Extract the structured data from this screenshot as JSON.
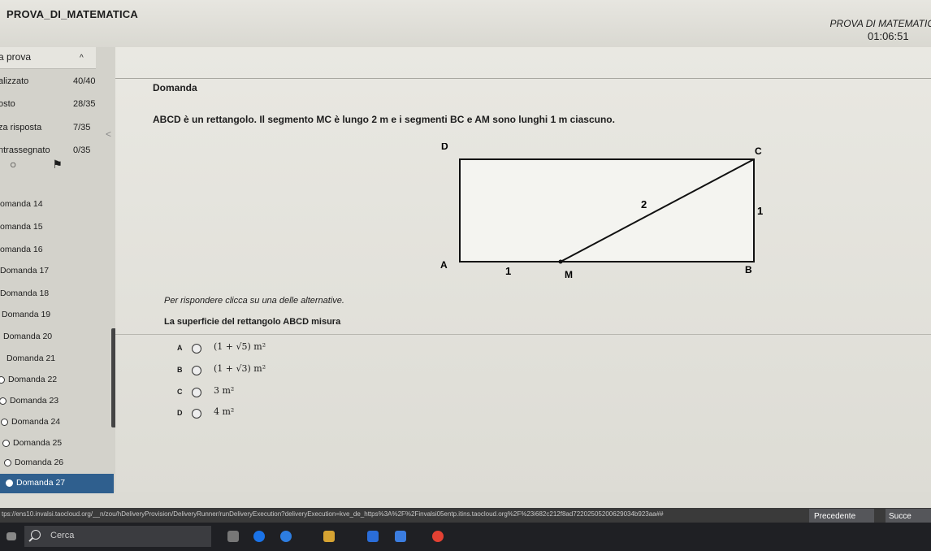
{
  "header": {
    "app_title": "PROVA_DI_MATEMATICA",
    "exam_name": "PROVA DI MATEMATIC",
    "timer": "01:06:51"
  },
  "sidebar": {
    "section_label": "a prova",
    "stats": [
      {
        "label": "alizzato",
        "value": "40/40"
      },
      {
        "label": "osto",
        "value": "28/35"
      },
      {
        "label": "za risposta",
        "value": "7/35"
      },
      {
        "label": "ntrassegnato",
        "value": "0/35"
      }
    ],
    "questions": [
      {
        "label": "omanda 14"
      },
      {
        "label": "omanda 15"
      },
      {
        "label": "omanda 16"
      },
      {
        "label": "Domanda 17"
      },
      {
        "label": "Domanda 18"
      },
      {
        "label": "Domanda 19"
      },
      {
        "label": "Domanda 20"
      },
      {
        "label": "Domanda 21"
      },
      {
        "label": "Domanda 22"
      },
      {
        "label": "Domanda 23"
      },
      {
        "label": "Domanda 24"
      },
      {
        "label": "Domanda 25"
      },
      {
        "label": "Domanda 26"
      },
      {
        "label": "Domanda 27"
      }
    ]
  },
  "question": {
    "title": "Domanda",
    "text": "ABCD è un rettangolo. Il segmento MC è lungo 2 m e i segmenti BC e AM sono lunghi 1 m ciascuno.",
    "figure": {
      "D": "D",
      "C": "C",
      "A": "A",
      "B": "B",
      "M": "M",
      "len_mc": "2",
      "len_bc": "1",
      "len_am": "1"
    },
    "instruction": "Per rispondere clicca su una delle alternative.",
    "prompt": "La superficie del rettangolo ABCD misura",
    "options": [
      {
        "letter": "A",
        "text": "(1 + √5) m²"
      },
      {
        "letter": "B",
        "text": "(1 + √3) m²"
      },
      {
        "letter": "C",
        "text": "3 m²"
      },
      {
        "letter": "D",
        "text": "4 m²"
      }
    ]
  },
  "url": "tps://ens10.invalsi.taocloud.org/__n/zou/hDeliveryProvision/DeliveryRunner/runDeliveryExecution?deliveryExecution=kve_de_https%3A%2F%2Finvalsi05entp.itins.taocloud.org%2F%23i682c212f8ad72202505200629034b923aa##",
  "nav": {
    "prev": "Precedente",
    "next": "Succe"
  },
  "taskbar": {
    "search": "Cerca"
  }
}
